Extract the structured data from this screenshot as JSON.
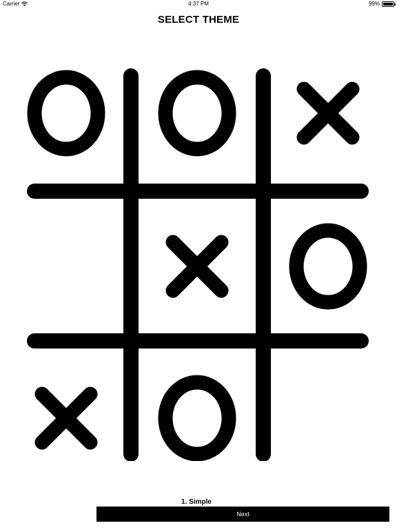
{
  "status_bar": {
    "carrier": "Carrier",
    "wifi_icon": "wifi-icon",
    "time": "4:37 PM",
    "battery_percent": "99%",
    "battery_level": 0.99,
    "battery_icon": "battery-icon"
  },
  "header": {
    "title": "SELECT THEME"
  },
  "theme_preview": {
    "board_cells": [
      "O",
      "O",
      "X",
      "",
      "X",
      "O",
      "X",
      "O",
      ""
    ],
    "colors": {
      "background": "#ffffff",
      "marks": "#000000"
    }
  },
  "theme_caption": "1. Simple",
  "next_button": {
    "label": "Next",
    "background": "#000000",
    "text_color": "#ffffff"
  }
}
